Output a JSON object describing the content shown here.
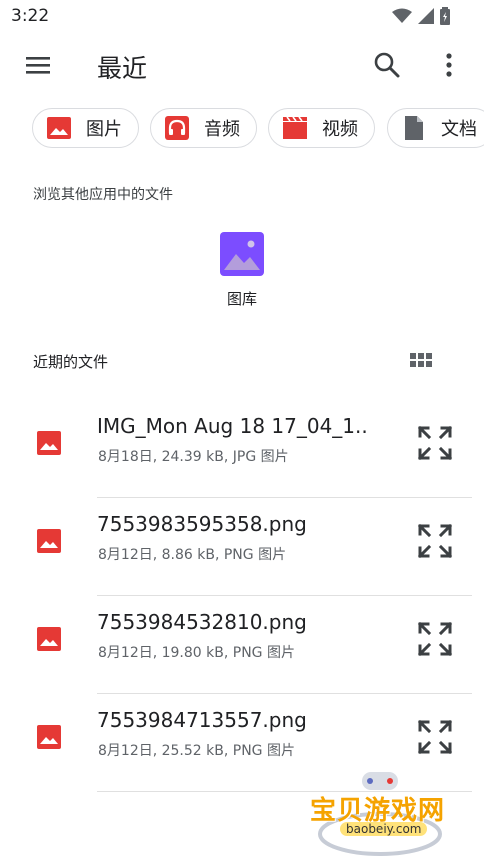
{
  "status_bar": {
    "time": "3:22"
  },
  "app_bar": {
    "title": "最近"
  },
  "chips": [
    {
      "label": "图片",
      "icon": "image-icon",
      "color": "#e53935"
    },
    {
      "label": "音频",
      "icon": "headphones-icon",
      "color": "#e53935"
    },
    {
      "label": "视频",
      "icon": "movie-icon",
      "color": "#e53935"
    },
    {
      "label": "文档",
      "icon": "document-icon",
      "color": "#5f6368"
    }
  ],
  "browse_section": {
    "title": "浏览其他应用中的文件",
    "apps": [
      {
        "label": "图库",
        "icon": "gallery-icon",
        "color": "#7c4dff"
      }
    ]
  },
  "recent_section": {
    "title": "近期的文件"
  },
  "files": [
    {
      "name": "IMG_Mon Aug 18 17_04_1...",
      "meta": "8月18日, 24.39 kB, JPG 图片"
    },
    {
      "name": "7553983595358.png",
      "meta": "8月12日, 8.86 kB, PNG 图片"
    },
    {
      "name": "7553984532810.png",
      "meta": "8月12日, 19.80 kB, PNG 图片"
    },
    {
      "name": "7553984713557.png",
      "meta": "8月12日, 25.52 kB, PNG 图片"
    }
  ],
  "watermark": {
    "text": "宝贝游戏网",
    "url": "baobeiy.com"
  },
  "colors": {
    "accent_red": "#e53935",
    "icon_gray": "#5f6368",
    "divider": "#e0e0e0"
  }
}
